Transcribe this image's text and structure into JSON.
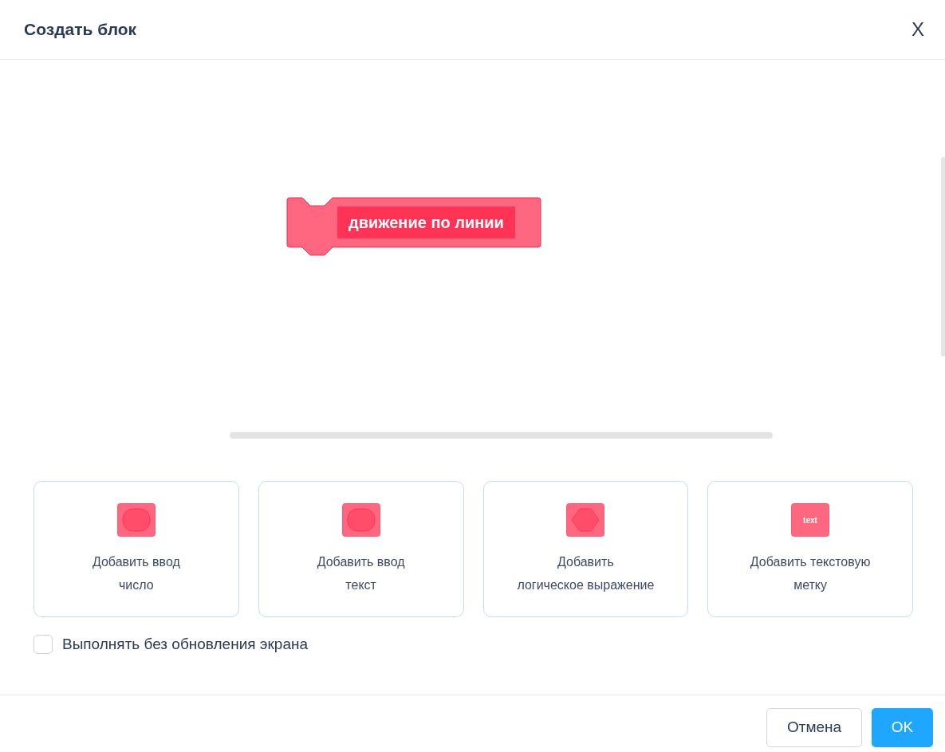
{
  "dialog": {
    "title": "Создать блок",
    "close": "X"
  },
  "block": {
    "label": "движение по линии"
  },
  "options": [
    {
      "kind": "number",
      "lines": [
        "Добавить ввод",
        "число"
      ]
    },
    {
      "kind": "text",
      "lines": [
        "Добавить ввод",
        "текст"
      ]
    },
    {
      "kind": "boolean",
      "lines": [
        "Добавить",
        "логическое выражение"
      ]
    },
    {
      "kind": "label",
      "icon_text": "text",
      "lines": [
        "Добавить текстовую",
        "метку"
      ]
    }
  ],
  "run_without_refresh": {
    "label": "Выполнять без обновления экрана",
    "checked": false
  },
  "buttons": [
    {
      "kind": "cancel",
      "label": "Отмена"
    },
    {
      "kind": "ok",
      "label": "OK"
    }
  ]
}
